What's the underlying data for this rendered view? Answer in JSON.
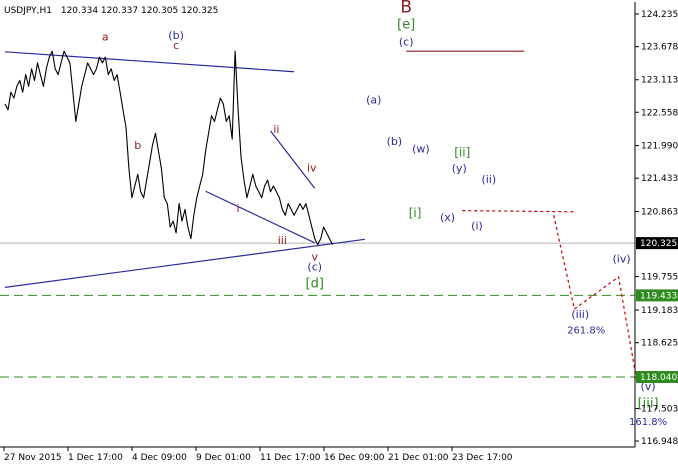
{
  "header": {
    "symbol": "USDJPY,H1",
    "ohlc": "120.334 120.337 120.305 120.325"
  },
  "colors": {
    "wave_blue": "#2a2aa0",
    "wave_red": "#8b1a1a",
    "wave_green": "#2e8b1e",
    "level_green": "#2e8b1e",
    "target_red": "#cc0000",
    "price_line": "#b0b0b0",
    "current_box": "#000000"
  },
  "chart_data": {
    "type": "line",
    "y_axis": {
      "ticks": [
        "124.235",
        "123.678",
        "123.113",
        "122.558",
        "121.990",
        "121.433",
        "120.863",
        "120.325",
        "119.755",
        "119.183",
        "118.625",
        "118.040",
        "117.503",
        "116.948"
      ],
      "current_price": "120.325",
      "levels": [
        "119.433",
        "118.040"
      ]
    },
    "x_axis": {
      "ticks": [
        "27 Nov 2015",
        "1 Dec 17:00",
        "4 Dec 09:00",
        "9 Dec 01:00",
        "11 Dec 17:00",
        "16 Dec 09:00",
        "21 Dec 01:00",
        "23 Dec 17:00"
      ]
    },
    "series": [
      {
        "values": [
          122.7,
          122.6,
          122.9,
          122.8,
          123.0,
          123.1,
          122.9,
          123.2,
          123.0,
          123.3,
          123.1,
          123.4,
          123.2,
          123.0,
          123.3,
          123.5,
          123.6,
          123.3,
          123.2,
          123.4,
          123.6,
          123.5,
          123.4,
          122.9,
          122.4,
          122.7,
          123.0,
          123.2,
          123.4,
          123.3,
          123.2,
          123.3,
          123.5,
          123.4,
          123.5,
          123.2,
          123.3,
          123.1,
          123.2,
          122.9,
          122.6,
          122.3,
          121.6,
          121.1,
          121.3,
          121.5,
          121.2,
          121.1,
          121.4,
          121.7,
          122.0,
          122.2,
          121.9,
          121.6,
          121.1,
          121.0,
          120.6,
          120.7,
          120.5,
          121.0,
          120.7,
          120.9,
          120.6,
          120.4,
          120.8,
          121.1,
          121.3,
          121.5,
          121.9,
          122.2,
          122.5,
          122.4,
          122.6,
          122.8,
          122.7,
          122.4,
          122.5,
          122.1,
          123.6,
          122.6,
          121.8,
          121.4,
          121.1,
          121.3,
          121.5,
          121.3,
          121.2,
          121.1,
          121.3,
          121.4,
          121.2,
          121.3,
          121.2,
          121.1,
          120.9,
          120.8,
          121.0,
          120.9,
          120.8,
          120.9,
          121.0,
          120.9,
          121.0,
          120.8,
          120.6,
          120.4,
          120.3,
          120.4,
          120.6,
          120.5,
          120.4,
          120.3
        ]
      }
    ],
    "trendlines": [
      {
        "name": "upper-channel",
        "color": "wave_blue",
        "from": [
          0,
          123.59
        ],
        "to": [
          98,
          123.25
        ]
      },
      {
        "name": "lower-channel",
        "color": "wave_blue",
        "from": [
          0,
          119.57
        ],
        "to": [
          122,
          120.39
        ]
      },
      {
        "name": "lower-wedge",
        "color": "wave_blue",
        "from": [
          68,
          121.21
        ],
        "to": [
          105,
          120.33
        ]
      },
      {
        "name": "upper-wedge",
        "color": "wave_blue",
        "from": [
          90,
          122.24
        ],
        "to": [
          105,
          121.26
        ]
      },
      {
        "name": "resistance-c",
        "color": "wave_red",
        "from": [
          136,
          123.6
        ],
        "to": [
          176,
          123.6
        ]
      }
    ],
    "targets": [
      {
        "name": "target-path",
        "points": [
          [
            186,
            120.8
          ],
          [
            193,
            119.2
          ],
          [
            208,
            119.75
          ],
          [
            214,
            118.02
          ]
        ]
      },
      {
        "name": "support-dotted",
        "points": [
          [
            155,
            120.88
          ],
          [
            193,
            120.86
          ]
        ]
      }
    ],
    "wave_labels": [
      {
        "text": "a",
        "color": "wave_red",
        "x": 34,
        "y": 123.78,
        "size": 11
      },
      {
        "text": "b",
        "color": "wave_red",
        "x": 45,
        "y": 121.93,
        "size": 11
      },
      {
        "text": "c",
        "color": "wave_red",
        "x": 58,
        "y": 123.64,
        "size": 11
      },
      {
        "text": "(b)",
        "color": "wave_blue",
        "x": 58,
        "y": 123.81,
        "size": 11
      },
      {
        "text": "i",
        "color": "wave_red",
        "x": 79,
        "y": 120.86,
        "size": 11
      },
      {
        "text": "ii",
        "color": "wave_red",
        "x": 92,
        "y": 122.2,
        "size": 11
      },
      {
        "text": "iii",
        "color": "wave_red",
        "x": 94,
        "y": 120.31,
        "size": 11
      },
      {
        "text": "iv",
        "color": "wave_red",
        "x": 104,
        "y": 121.55,
        "size": 11
      },
      {
        "text": "v",
        "color": "wave_red",
        "x": 105,
        "y": 120.03,
        "size": 11
      },
      {
        "text": "(c)",
        "color": "wave_blue",
        "x": 105,
        "y": 119.86,
        "size": 11
      },
      {
        "text": "[d]",
        "color": "wave_green",
        "x": 105,
        "y": 119.57,
        "size": 13
      },
      {
        "text": "(a)",
        "color": "wave_blue",
        "x": 125,
        "y": 122.71,
        "size": 11
      },
      {
        "text": "(b)",
        "color": "wave_blue",
        "x": 132,
        "y": 122.0,
        "size": 11
      },
      {
        "text": "B",
        "color": "wave_red",
        "x": 136,
        "y": 124.26,
        "size": 17
      },
      {
        "text": "[e]",
        "color": "wave_green",
        "x": 136,
        "y": 123.99,
        "size": 13
      },
      {
        "text": "(c)",
        "color": "wave_blue",
        "x": 136,
        "y": 123.7,
        "size": 11
      },
      {
        "text": "(w)",
        "color": "wave_blue",
        "x": 141,
        "y": 121.87,
        "size": 11
      },
      {
        "text": "[i]",
        "color": "wave_green",
        "x": 139,
        "y": 120.77,
        "size": 12
      },
      {
        "text": "[ii]",
        "color": "wave_green",
        "x": 155,
        "y": 121.8,
        "size": 12
      },
      {
        "text": "(y)",
        "color": "wave_blue",
        "x": 154,
        "y": 121.54,
        "size": 11
      },
      {
        "text": "(x)",
        "color": "wave_blue",
        "x": 150,
        "y": 120.7,
        "size": 11
      },
      {
        "text": "(ii)",
        "color": "wave_blue",
        "x": 164,
        "y": 121.35,
        "size": 11
      },
      {
        "text": "(i)",
        "color": "wave_blue",
        "x": 160,
        "y": 120.56,
        "size": 11
      },
      {
        "text": "(iv)",
        "color": "wave_blue",
        "x": 209,
        "y": 119.99,
        "size": 11
      },
      {
        "text": "(iii)",
        "color": "wave_blue",
        "x": 195,
        "y": 119.05,
        "size": 11
      },
      {
        "text": "261.8%",
        "color": "wave_blue",
        "x": 197,
        "y": 118.78,
        "size": 10
      },
      {
        "text": "(v)",
        "color": "wave_blue",
        "x": 218,
        "y": 117.82,
        "size": 11
      },
      {
        "text": "[iii]",
        "color": "wave_green",
        "x": 218,
        "y": 117.52,
        "size": 13
      },
      {
        "text": "161.8%",
        "color": "wave_blue",
        "x": 218,
        "y": 117.22,
        "size": 10
      }
    ]
  }
}
